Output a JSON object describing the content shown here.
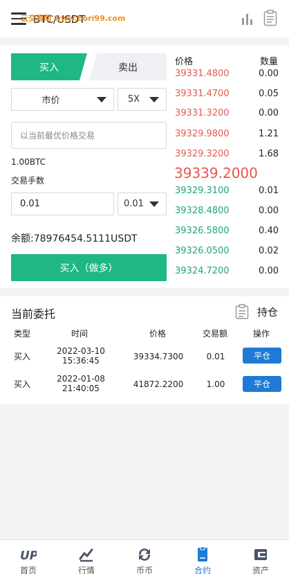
{
  "header": {
    "pair": "BTC/USDT",
    "watermark": "云交易网 www.bori99.com",
    "icons": [
      "menu-icon",
      "bar-chart-icon",
      "document-icon"
    ]
  },
  "trade": {
    "tab_buy": "买入",
    "tab_sell": "卖出",
    "order_type": "市价",
    "leverage": "5X",
    "price_placeholder": "以当前最优价格交易",
    "amount_text": "1.00BTC",
    "fee_label": "交易手数",
    "quantity_value": "0.01",
    "quantity_select": "0.01",
    "balance_label": "余额:",
    "balance_value": "78976454.5111USDT",
    "buy_button": "买入（做多）"
  },
  "orderbook": {
    "price_header": "价格",
    "qty_header": "数量",
    "asks": [
      {
        "price": "39331.4800",
        "qty": "0.00"
      },
      {
        "price": "39331.4700",
        "qty": "0.05"
      },
      {
        "price": "39331.3200",
        "qty": "0.00"
      },
      {
        "price": "39329.9800",
        "qty": "1.21"
      },
      {
        "price": "39329.3200",
        "qty": "1.68"
      }
    ],
    "last_price": "39339.2000",
    "bids": [
      {
        "price": "39329.3100",
        "qty": "0.01"
      },
      {
        "price": "39328.4800",
        "qty": "0.00"
      },
      {
        "price": "39326.5800",
        "qty": "0.40"
      },
      {
        "price": "39326.0500",
        "qty": "0.02"
      },
      {
        "price": "39324.7200",
        "qty": "0.00"
      }
    ],
    "colors": {
      "ask": "#e15b4f",
      "bid": "#22a578"
    }
  },
  "orders": {
    "title": "当前委托",
    "positions_link": "持仓",
    "columns": [
      "类型",
      "时间",
      "价格",
      "交易额",
      "操作"
    ],
    "rows": [
      {
        "type": "买入",
        "date": "2022-03-10",
        "time": "15:36:45",
        "price": "39334.7300",
        "amount": "0.01",
        "action": "平仓"
      },
      {
        "type": "买入",
        "date": "2022-01-08",
        "time": "21:40:05",
        "price": "41872.2200",
        "amount": "1.00",
        "action": "平仓"
      }
    ]
  },
  "nav": {
    "items": [
      {
        "label": "首页",
        "icon": "up-logo-icon"
      },
      {
        "label": "行情",
        "icon": "market-icon"
      },
      {
        "label": "币币",
        "icon": "exchange-icon"
      },
      {
        "label": "合约",
        "icon": "contract-icon"
      },
      {
        "label": "资产",
        "icon": "wallet-icon"
      }
    ],
    "active": "合约",
    "accent": "#1e7ad6"
  }
}
